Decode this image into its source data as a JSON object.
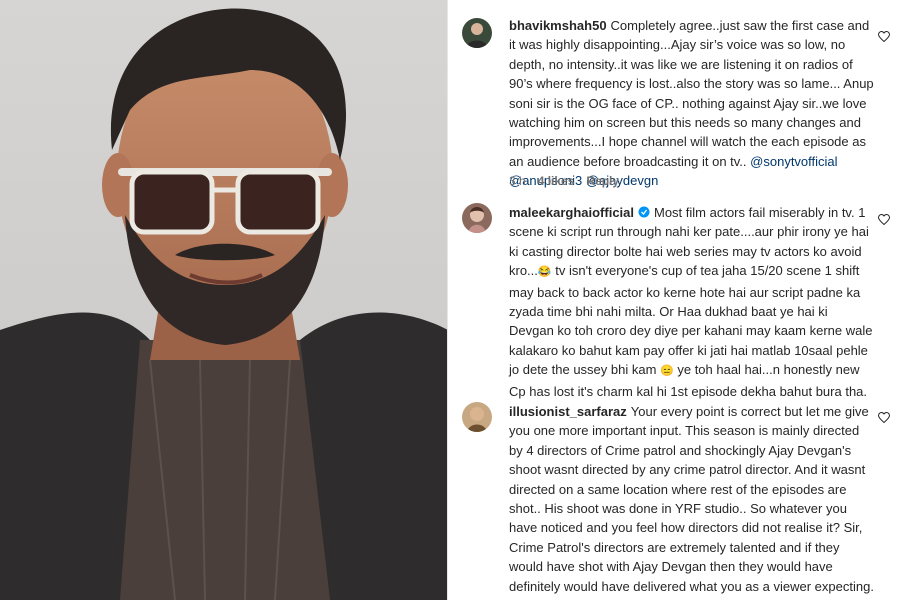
{
  "comments": [
    {
      "username": "bhavikmshah50",
      "verified": false,
      "text": "Completely agree..just saw the first case and it was highly disappointing...Ajay sir’s voice was so low, no depth, no intensity..it was like we are listening it on radios of 90’s where frequency is lost..also the story was so lame... Anup soni sir is the OG face of CP.. nothing against Ajay sir..we love watching him on screen but this needs so many changes and improvements...I hope channel will watch the each episode as an audience before broadcasting it on tv..",
      "mentions": [
        "@sonytvofficial",
        "@anupsoni3",
        "@ajaydevgn"
      ],
      "time": "3 h",
      "likes": "4 likes",
      "reply_label": "Reply",
      "avatar_icon": "user-avatar"
    },
    {
      "username": "maleekarghaiofficial",
      "verified": true,
      "text_part1": "Most film actors fail miserably in tv. 1 scene ki script run through nahi ker pate....aur phir irony ye hai ki casting director bolte hai web series may tv actors ko avoid kro...",
      "emoji1": "😂",
      "text_part2": " tv isn't everyone's cup of tea jaha 15/20 scene 1 shift may back to back actor ko kerne hote hai aur script padne ka zyada time bhi nahi milta. Or Haa dukhad baat ye hai ki Devgan ko toh croro dey diye per kahani may kaam kerne wale kalakaro ko bahut kam pay offer ki jati hai matlab 10saal pehle jo dete the ussey bhi kam ",
      "emoji2": "😑",
      "text_part3": " ye toh haal hai...n honestly new Cp has lost it's charm kal hi 1st episode dekha bahut bura tha.",
      "avatar_icon": "user-avatar"
    },
    {
      "username": "illusionist_sarfaraz",
      "verified": false,
      "text": "Your every point is correct but let me give you one more important input. This season is mainly directed by 4 directors of Crime patrol and shockingly Ajay Devgan's shoot wasnt directed by any crime patrol director. And it wasnt directed on a same location where rest of the episodes are shot.. His shoot was done in YRF studio.. So whatever you have noticed and you feel how directors did not realise it? Sir, Crime Patrol's directors are extremely talented and if they would have shot with Ajay Devgan then they would have definitely would have delivered what you as a viewer expecting. But i really thank you for being Crime Patrol's veiwer",
      "emoji_end": "❤️",
      "avatar_icon": "user-avatar"
    }
  ],
  "colors": {
    "text": "#262626",
    "meta": "#737373",
    "mention": "#00376b",
    "verified": "#0095f6"
  }
}
